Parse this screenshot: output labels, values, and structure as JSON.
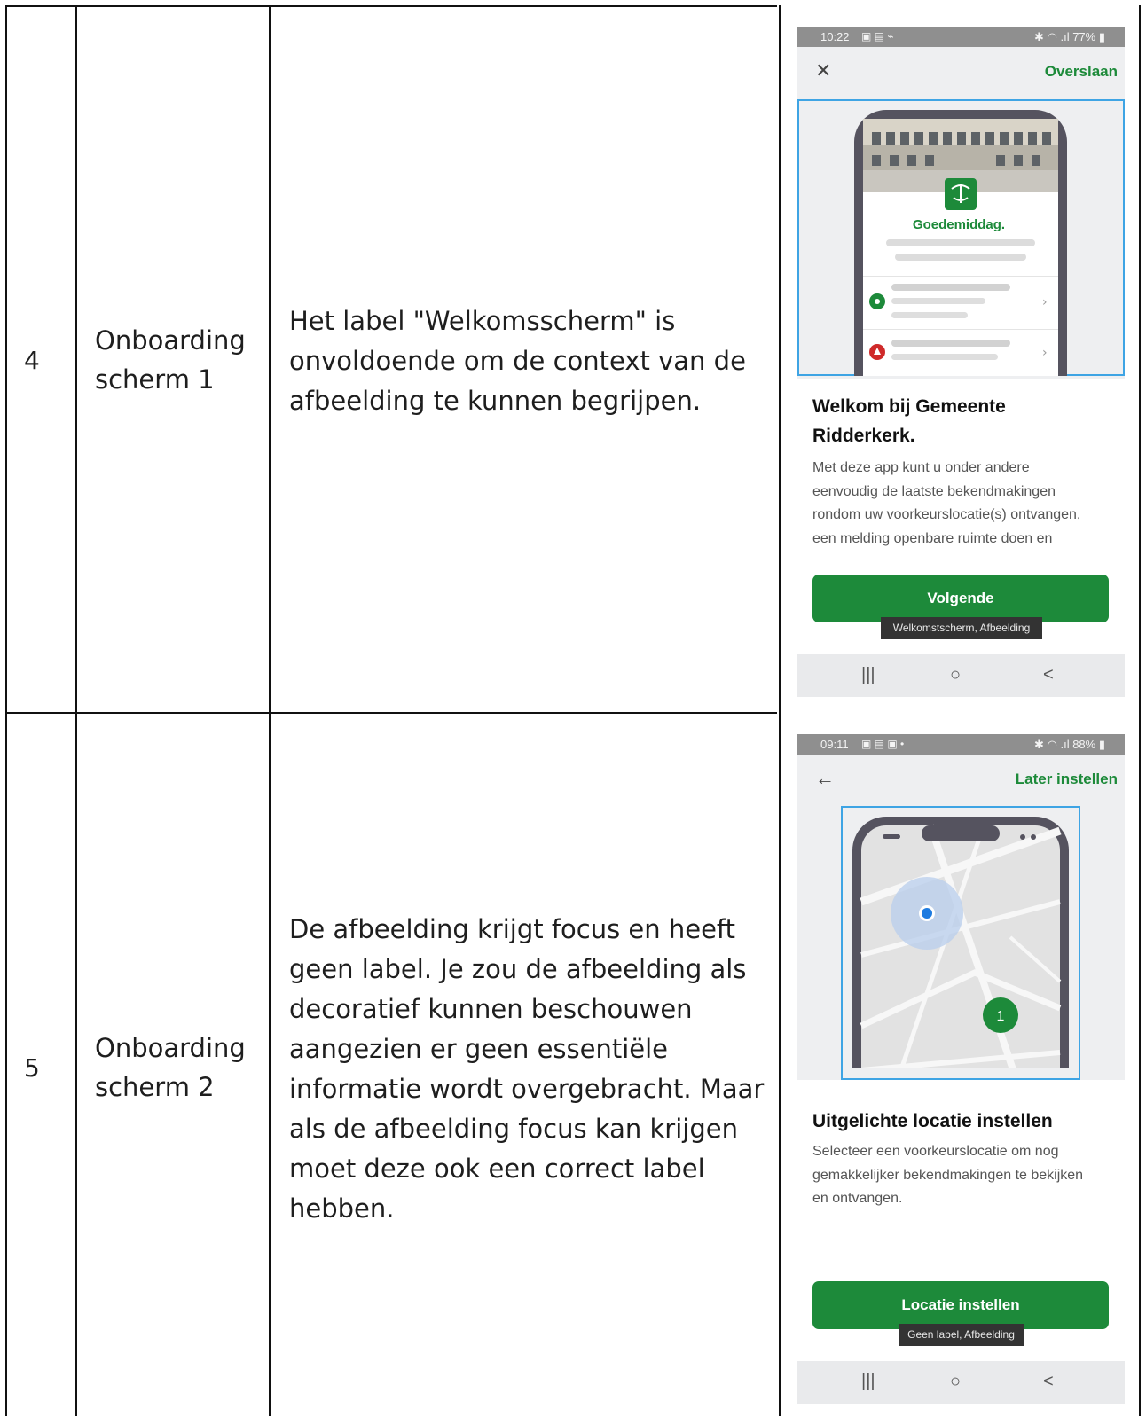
{
  "rows": [
    {
      "number": "4",
      "screen_name_line1": "Onboarding",
      "screen_name_line2": "scherm 1",
      "description_lines": [
        "Het label \"Welkomsscherm\" is",
        "onvoldoende om de context van de",
        "afbeelding te kunnen begrijpen."
      ],
      "phone": {
        "status_time": "10:22",
        "status_battery": "77%",
        "leading_icon": "close-icon",
        "action": "Overslaan",
        "greeting": "Goedemiddag.",
        "title_line1": "Welkom bij Gemeente",
        "title_line2": "Ridderkerk.",
        "body_lines": [
          "Met deze app kunt u onder andere",
          "eenvoudig de laatste bekendmakingen",
          "rondom uw voorkeurslocatie(s) ontvangen,",
          "een melding openbare ruimte doen en"
        ],
        "button": "Volgende",
        "tooltip": "Welkomstscherm, Afbeelding",
        "nav": [
          "|||",
          "○",
          "<"
        ]
      }
    },
    {
      "number": "5",
      "screen_name_line1": "Onboarding",
      "screen_name_line2": "scherm 2",
      "description_lines": [
        "De afbeelding krijgt focus en heeft",
        "geen label. Je zou de afbeelding als",
        "decoratief kunnen beschouwen",
        "aangezien er geen essentiële",
        "informatie wordt overgebracht. Maar",
        "als de afbeelding focus kan krijgen",
        "moet deze ook een correct label",
        "hebben."
      ],
      "phone": {
        "status_time": "09:11",
        "status_battery": "88%",
        "leading_icon": "back-arrow-icon",
        "action": "Later instellen",
        "marker_label": "1",
        "title_line1": "Uitgelichte locatie instellen",
        "body_lines": [
          "Selecteer een voorkeurslocatie om nog",
          "gemakkelijker bekendmakingen te bekijken",
          "en ontvangen."
        ],
        "button": "Locatie instellen",
        "tooltip": "Geen label, Afbeelding",
        "nav": [
          "|||",
          "○",
          "<"
        ]
      }
    }
  ],
  "colors": {
    "brand_green": "#1d8a3a",
    "focus_blue": "#3ea4e4",
    "status_grey": "#8f8f8f",
    "map_marker_blue": "#1e7be0"
  }
}
